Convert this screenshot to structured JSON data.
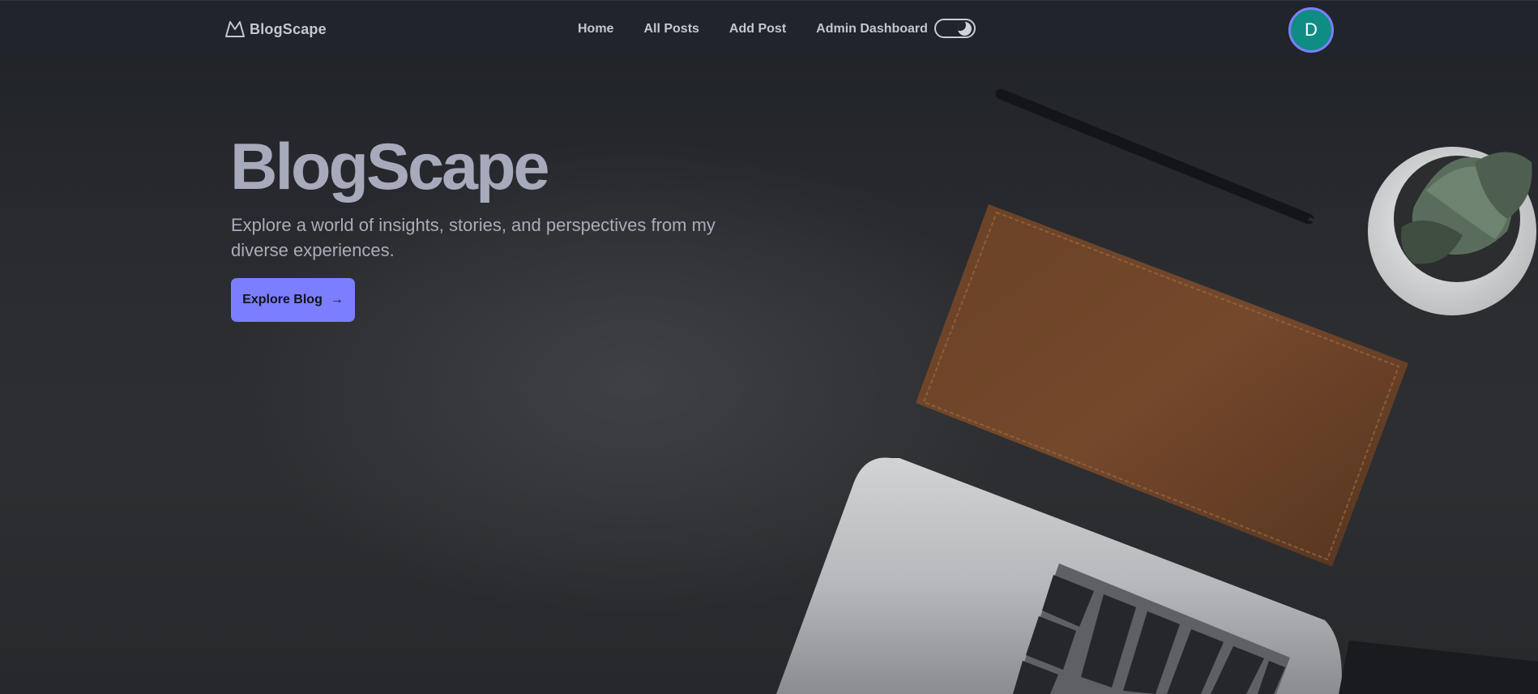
{
  "navbar": {
    "brand": "BlogScape",
    "links": [
      "Home",
      "All Posts",
      "Add Post",
      "Admin Dashboard"
    ],
    "avatar_initial": "D"
  },
  "hero": {
    "title": "BlogScape",
    "subtitle": "Explore a world of insights, stories, and perspectives from my diverse experiences.",
    "cta_label": "Explore Blog"
  },
  "colors": {
    "nav_background": "#20242b",
    "nav_text": "#c3c7cf",
    "accent": "#7b7eff",
    "avatar_background": "#0f8c84",
    "hero_title": "#a6aabb"
  },
  "icons": {
    "brand": "mountain-logo-icon",
    "theme_toggle": "moon-icon",
    "cta": "arrow-right-icon"
  }
}
